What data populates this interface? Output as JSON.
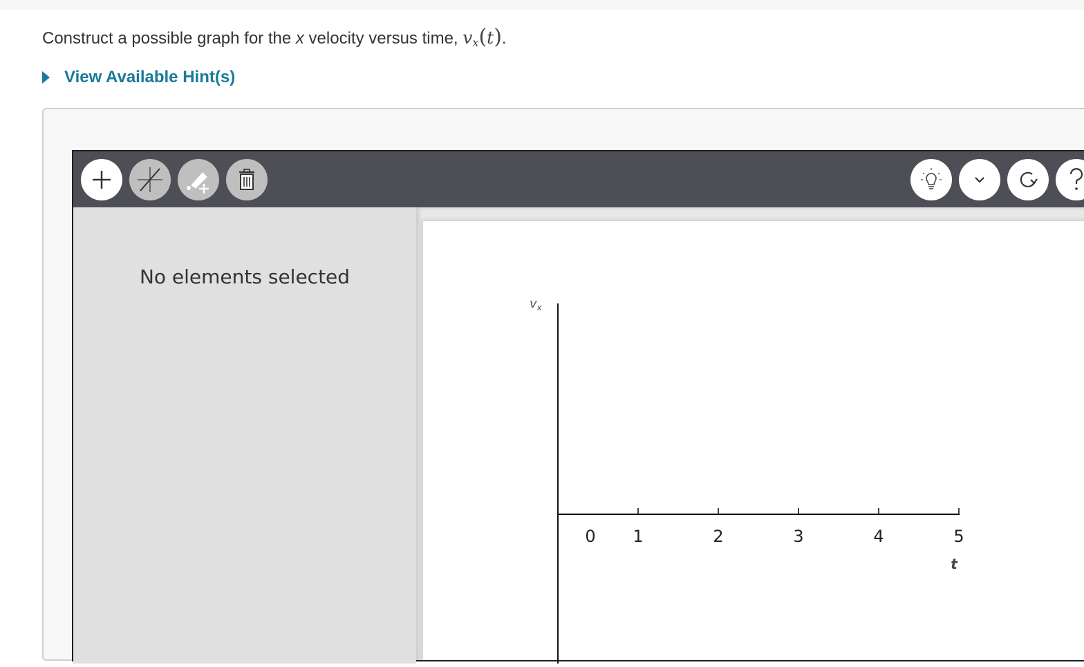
{
  "question": {
    "text_before": "Construct a possible graph for the ",
    "text_var": "x",
    "text_after": " velocity versus time, ",
    "math_v": "v",
    "math_sub": "x",
    "math_open": "(",
    "math_t": "t",
    "math_close": ")",
    "text_end": "."
  },
  "hint": {
    "label": "View Available Hint(s)"
  },
  "toolbar": {
    "left_tools": [
      "add-icon",
      "line-cross-icon",
      "pencil-add-icon",
      "trash-icon"
    ],
    "right_tools": [
      "lightbulb-icon",
      "chevron-down-icon",
      "redo-icon",
      "help-icon"
    ]
  },
  "sidepanel": {
    "message": "No elements selected"
  },
  "graph": {
    "y_axis_label": "v",
    "y_axis_sub": "x",
    "x_axis_label": "t",
    "x_ticks": [
      "0",
      "1",
      "2",
      "3",
      "4",
      "5"
    ]
  },
  "colors": {
    "accent": "#1a7a9a",
    "toolbar": "#4e4f56",
    "panel": "#e0e0e0"
  }
}
